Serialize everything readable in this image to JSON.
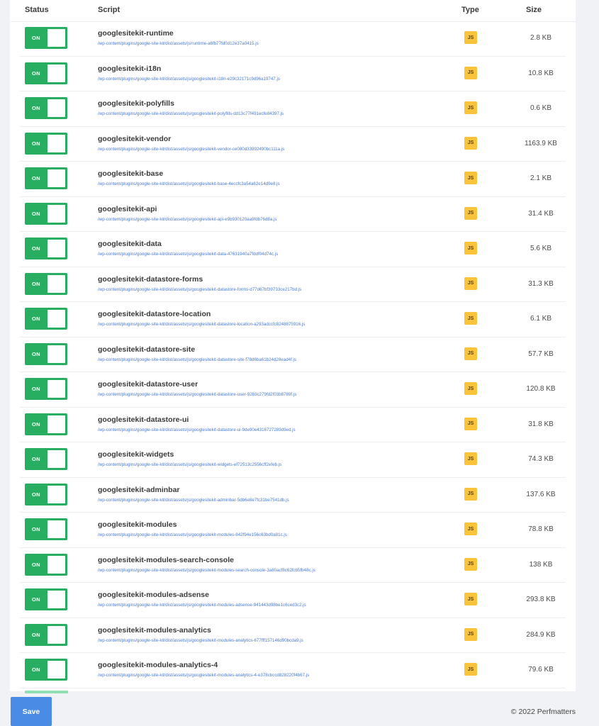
{
  "table": {
    "headers": {
      "status": "Status",
      "script": "Script",
      "type": "Type",
      "size": "Size"
    },
    "rows": [
      {
        "status": "ON",
        "name": "googlesitekit-runtime",
        "path": "/wp-content/plugins/google-site-kit/dist/assets/js/runtime-a6fb77fd0d12e37a0415.js",
        "type": "JS",
        "size": "2.8 KB"
      },
      {
        "status": "ON",
        "name": "googlesitekit-i18n",
        "path": "/wp-content/plugins/google-site-kit/dist/assets/js/googlesitekit-i18n-e29c32171c9d96a19747.js",
        "type": "JS",
        "size": "10.8 KB"
      },
      {
        "status": "ON",
        "name": "googlesitekit-polyfills",
        "path": "/wp-content/plugins/google-site-kit/dist/assets/js/googlesitekit-polyfills-dd13c77f491ecfe84397.js",
        "type": "JS",
        "size": "0.6 KB"
      },
      {
        "status": "ON",
        "name": "googlesitekit-vendor",
        "path": "/wp-content/plugins/google-site-kit/dist/assets/js/googlesitekit-vendor-ce080d33992490bc111a.js",
        "type": "JS",
        "size": "1163.9 KB"
      },
      {
        "status": "ON",
        "name": "googlesitekit-base",
        "path": "/wp-content/plugins/google-site-kit/dist/assets/js/googlesitekit-base-4eccfc3a54a62e14d9e8.js",
        "type": "JS",
        "size": "2.1 KB"
      },
      {
        "status": "ON",
        "name": "googlesitekit-api",
        "path": "/wp-content/plugins/google-site-kit/dist/assets/js/googlesitekit-api-e9b930120aa9fdb76d8a.js",
        "type": "JS",
        "size": "31.4 KB"
      },
      {
        "status": "ON",
        "name": "googlesitekit-data",
        "path": "/wp-content/plugins/google-site-kit/dist/assets/js/googlesitekit-data-47631940a7fddf04d74c.js",
        "type": "JS",
        "size": "5.6 KB"
      },
      {
        "status": "ON",
        "name": "googlesitekit-datastore-forms",
        "path": "/wp-content/plugins/google-site-kit/dist/assets/js/googlesitekit-datastore-forms-d77d67bf39733ce217bd.js",
        "type": "JS",
        "size": "31.3 KB"
      },
      {
        "status": "ON",
        "name": "googlesitekit-datastore-location",
        "path": "/wp-content/plugins/google-site-kit/dist/assets/js/googlesitekit-datastore-location-a293adccfc8248875916.js",
        "type": "JS",
        "size": "6.1 KB"
      },
      {
        "status": "ON",
        "name": "googlesitekit-datastore-site",
        "path": "/wp-content/plugins/google-site-kit/dist/assets/js/googlesitekit-datastore-site-f78d6ba61b24d28ead4f.js",
        "type": "JS",
        "size": "57.7 KB"
      },
      {
        "status": "ON",
        "name": "googlesitekit-datastore-user",
        "path": "/wp-content/plugins/google-site-kit/dist/assets/js/googlesitekit-datastore-user-92b3c279fd2f03b8789f.js",
        "type": "JS",
        "size": "120.8 KB"
      },
      {
        "status": "ON",
        "name": "googlesitekit-datastore-ui",
        "path": "/wp-content/plugins/google-site-kit/dist/assets/js/googlesitekit-datastore-ui-9de90e4316727289d9ed.js",
        "type": "JS",
        "size": "31.8 KB"
      },
      {
        "status": "ON",
        "name": "googlesitekit-widgets",
        "path": "/wp-content/plugins/google-site-kit/dist/assets/js/googlesitekit-widgets-ef72513c2556cff2efeb.js",
        "type": "JS",
        "size": "74.3 KB"
      },
      {
        "status": "ON",
        "name": "googlesitekit-adminbar",
        "path": "/wp-content/plugins/google-site-kit/dist/assets/js/googlesitekit-adminbar-5db6e8e7fc31be7541db.js",
        "type": "JS",
        "size": "137.6 KB"
      },
      {
        "status": "ON",
        "name": "googlesitekit-modules",
        "path": "/wp-content/plugins/google-site-kit/dist/assets/js/googlesitekit-modules-842f94e156c63bd0a81c.js",
        "type": "JS",
        "size": "78.8 KB"
      },
      {
        "status": "ON",
        "name": "googlesitekit-modules-search-console",
        "path": "/wp-content/plugins/google-site-kit/dist/assets/js/googlesitekit-modules-search-console-3a80acf8c62fcb5fb48c.js",
        "type": "JS",
        "size": "138 KB"
      },
      {
        "status": "ON",
        "name": "googlesitekit-modules-adsense",
        "path": "/wp-content/plugins/google-site-kit/dist/assets/js/googlesitekit-modules-adsense-941443d98be1c6ced3c2.js",
        "type": "JS",
        "size": "293.8 KB"
      },
      {
        "status": "ON",
        "name": "googlesitekit-modules-analytics",
        "path": "/wp-content/plugins/google-site-kit/dist/assets/js/googlesitekit-modules-analytics-677fff157146d90bcda9.js",
        "type": "JS",
        "size": "284.9 KB"
      },
      {
        "status": "ON",
        "name": "googlesitekit-modules-analytics-4",
        "path": "/wp-content/plugins/google-site-kit/dist/assets/js/googlesitekit-modules-analytics-4-e378cbccd828220f4b67.js",
        "type": "JS",
        "size": "79.6 KB"
      }
    ]
  },
  "footer": {
    "save_label": "Save",
    "copyright": "© 2022 Perfmatters"
  },
  "colors": {
    "toggle_on": "#27ae60",
    "js_badge": "#f9c33c",
    "link": "#4a7bd6",
    "save_button": "#4a8be6"
  }
}
